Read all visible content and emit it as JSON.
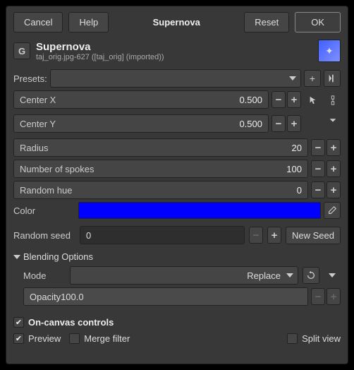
{
  "topbar": {
    "cancel": "Cancel",
    "help": "Help",
    "title": "Supernova",
    "reset": "Reset",
    "ok": "OK"
  },
  "header": {
    "icon": "G",
    "title": "Supernova",
    "subtitle": "taj_orig.jpg-627 ([taj_orig] (imported))"
  },
  "presets": {
    "label": "Presets:"
  },
  "params": {
    "centerX": {
      "label": "Center X",
      "value": "0.500"
    },
    "centerY": {
      "label": "Center Y",
      "value": "0.500"
    },
    "radius": {
      "label": "Radius",
      "value": "20"
    },
    "spokes": {
      "label": "Number of spokes",
      "value": "100"
    },
    "randhue": {
      "label": "Random hue",
      "value": "0"
    }
  },
  "color": {
    "label": "Color",
    "value": "#0000ff"
  },
  "seed": {
    "label": "Random seed",
    "value": "0",
    "newSeed": "New Seed"
  },
  "blend": {
    "title": "Blending Options",
    "modeLabel": "Mode",
    "modeValue": "Replace",
    "opacityLabel": "Opacity",
    "opacityValue": "100.0"
  },
  "checks": {
    "onCanvas": "On-canvas controls",
    "preview": "Preview",
    "merge": "Merge filter",
    "split": "Split view"
  }
}
